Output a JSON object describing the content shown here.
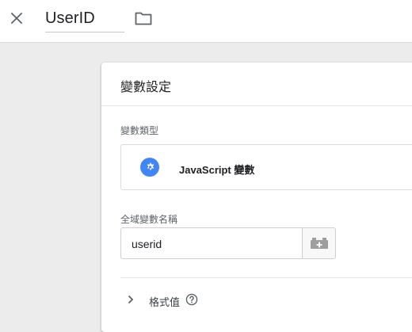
{
  "topbar": {
    "close_icon": "close-icon",
    "variable_name": "UserID",
    "folder_icon": "folder-icon"
  },
  "card": {
    "title": "變數設定",
    "variable_type_label": "變數類型",
    "variable_type_value": "JavaScript 變數",
    "variable_type_icon": "gear-icon",
    "global_name_label": "全域變數名稱",
    "global_name_value": "userid",
    "variable_picker_icon": "variable-lego-icon",
    "format_value_label": "格式值",
    "help_icon": "help-icon"
  },
  "colors": {
    "accent_blue": "#4285f4",
    "icon_gray": "#5f6368"
  }
}
